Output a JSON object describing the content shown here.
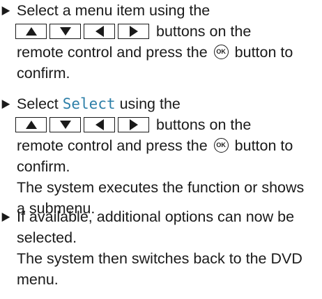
{
  "steps": [
    {
      "line1": "Select a menu item using the",
      "keys_tail": "buttons on the",
      "line3_pre": "remote control and press the",
      "ok_label": "OK",
      "line3_post": "button to",
      "line4": "confirm."
    },
    {
      "line1_pre": "Select",
      "line1_code": "Select",
      "line1_post": "using the",
      "keys_tail": "buttons on the",
      "line3_pre": "remote control and press the",
      "ok_label": "OK",
      "line3_post": "button to",
      "line4": "confirm.",
      "result1": "The system executes the function or shows",
      "result2": "a submenu."
    },
    {
      "line1": "If available, additional options can now be",
      "line2": "selected.",
      "result1": "The system then switches back to the DVD",
      "result2": "menu."
    }
  ],
  "icons": {
    "bullet": "triangle-right-bullet-icon",
    "keys": [
      "arrow-up-icon",
      "arrow-down-icon",
      "arrow-left-icon",
      "arrow-right-icon"
    ],
    "ok": "ok-button-icon"
  }
}
